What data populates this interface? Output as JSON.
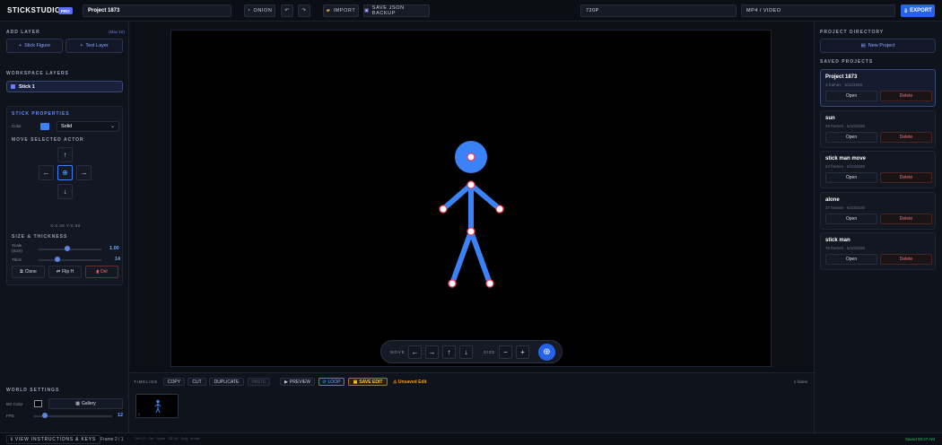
{
  "topbar": {
    "logo": "STICKSTUDIO",
    "pro_badge": "PRO",
    "project_name": "Project 1873",
    "onion_label": "ONION",
    "undo_icon": "undo-icon",
    "redo_icon": "redo-icon",
    "import_label": "IMPORT",
    "save_json_label": "SAVE JSON BACKUP",
    "resolution": "720P",
    "format": "MP4 / VIDEO",
    "export_label": "EXPORT"
  },
  "left": {
    "add_layer_title": "ADD LAYER",
    "max_label": "(Max 10)",
    "stick_figure_btn": "Stick Figure",
    "text_layer_btn": "Text Layer",
    "workspace_title": "WORKSPACE LAYERS",
    "layer_name": "Stick 1",
    "props_title": "STICK PROPERTIES",
    "color_label": "Color",
    "color_value": "#3b82f6",
    "line_style": "Solid",
    "move_title": "MOVE SELECTED ACTOR",
    "coords": "X:0.48 Y:0.58",
    "size_title": "SIZE & THICKNESS",
    "scale_label": "Scale",
    "scale_sub": "(Size)",
    "scale_value": "1.00",
    "scale_fraction": 0.45,
    "thick_label": "Thick",
    "thick_value": "14",
    "thick_fraction": 0.3,
    "clone_btn": "Clone",
    "flip_btn": "Flip H",
    "del_btn": "Del",
    "world_title": "WORLD SETTINGS",
    "bg_label": "BG Color",
    "gallery_btn": "Gallery",
    "fps_label": "FPS",
    "fps_value": "12",
    "fps_fraction": 0.15
  },
  "stage": {
    "move_label": "MOVE",
    "size_label": "SIZE",
    "minus": "−",
    "plus": "+"
  },
  "timeline": {
    "label": "TIMELINE",
    "copy": "COPY",
    "cut": "CUT",
    "duplicate": "DUPLICATE",
    "paste": "PASTE",
    "preview": "PREVIEW",
    "loop": "LOOP",
    "save_edit": "SAVE EDIT",
    "unsaved": "Unsaved Edit",
    "frames": "1 frame",
    "thumb_num": "1"
  },
  "right": {
    "directory_title": "PROJECT DIRECTORY",
    "new_project": "New Project",
    "saved_title": "SAVED PROJECTS",
    "open_label": "Open",
    "delete_label": "Delete",
    "projects": [
      {
        "name": "Project 1873",
        "meta": "1 frames · 6/11/2026"
      },
      {
        "name": "sun",
        "meta": "39 frames · 6/10/2026"
      },
      {
        "name": "stick man move",
        "meta": "24 frames · 6/10/2026"
      },
      {
        "name": "alone",
        "meta": "37 frames · 6/10/2026"
      },
      {
        "name": "stick man",
        "meta": "76 frames · 6/10/2026"
      }
    ]
  },
  "footer": {
    "instructions": "VIEW INSTRUCTIONS & KEYS",
    "frame_indicator": "Frame 2 / 1",
    "hints": "Ctrl+Z/Y · Del · Space · ⌫ Del · Drag · Arrows",
    "saved_time": "Saved 00:47 AM"
  }
}
